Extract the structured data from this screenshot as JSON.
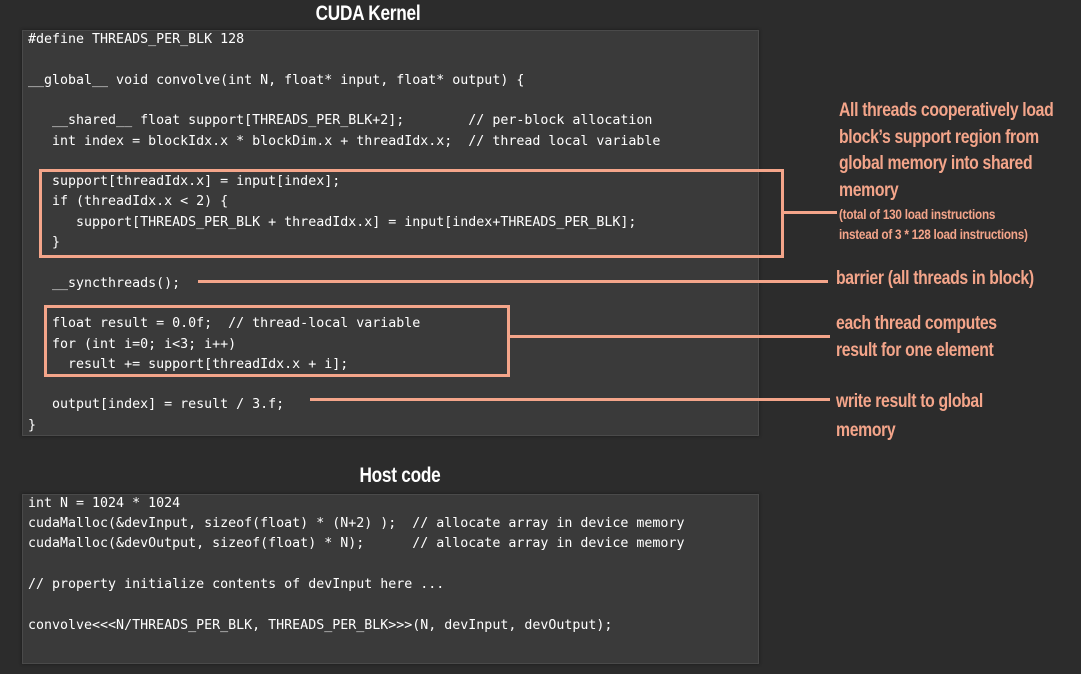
{
  "kernel": {
    "title": "CUDA Kernel",
    "lines": [
      "#define THREADS_PER_BLK 128",
      "",
      "__global__ void convolve(int N, float* input, float* output) {",
      "",
      "   __shared__ float support[THREADS_PER_BLK+2];        // per-block allocation",
      "   int index = blockIdx.x * blockDim.x + threadIdx.x;  // thread local variable",
      "",
      "   support[threadIdx.x] = input[index];",
      "   if (threadIdx.x < 2) {",
      "      support[THREADS_PER_BLK + threadIdx.x] = input[index+THREADS_PER_BLK];",
      "   }",
      "",
      "   __syncthreads();",
      "",
      "   float result = 0.0f;  // thread-local variable",
      "   for (int i=0; i<3; i++)",
      "     result += support[threadIdx.x + i];",
      "",
      "   output[index] = result / 3.f;",
      "}"
    ]
  },
  "host": {
    "title": "Host code",
    "lines": [
      "int N = 1024 * 1024",
      "cudaMalloc(&devInput, sizeof(float) * (N+2) );  // allocate array in device memory",
      "cudaMalloc(&devOutput, sizeof(float) * N);      // allocate array in device memory",
      "",
      "// property initialize contents of devInput here ...",
      "",
      "convolve<<<N/THREADS_PER_BLK, THREADS_PER_BLK>>>(N, devInput, devOutput);"
    ]
  },
  "annotations": {
    "load": {
      "lines": [
        "All threads cooperatively load",
        "block’s support region from",
        "global memory into shared",
        "memory"
      ],
      "sub_lines": [
        "(total of 130 load instructions",
        "instead of 3 * 128 load instructions)"
      ]
    },
    "sync": {
      "lines": [
        "barrier (all threads in block)"
      ]
    },
    "compute": {
      "lines": [
        "each thread computes",
        "result for one element"
      ]
    },
    "write": {
      "lines": [
        "write result to global",
        "memory"
      ]
    }
  },
  "colors": {
    "background": "#2c2c2c",
    "code_panel": "#3a3a3a",
    "code_text": "#ffffff",
    "accent": "#f4a58a"
  }
}
